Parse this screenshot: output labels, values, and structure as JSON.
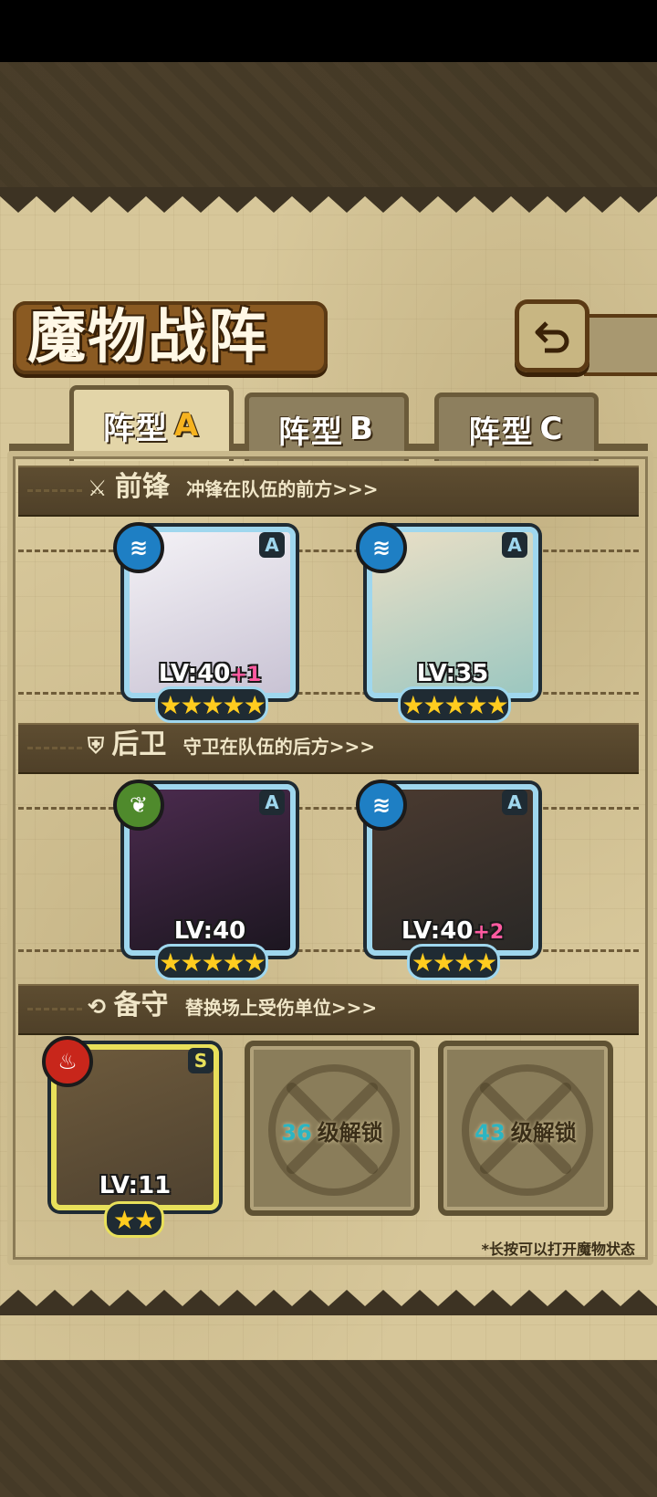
{
  "title": "魔物战阵",
  "back_button": {
    "icon": "back-arrow-icon"
  },
  "tabs": [
    {
      "label": "阵型",
      "letter": "A",
      "active": true
    },
    {
      "label": "阵型",
      "letter": "B",
      "active": false
    },
    {
      "label": "阵型",
      "letter": "C",
      "active": false
    }
  ],
  "sections": {
    "front": {
      "head": "前锋",
      "desc": "冲锋在队伍的前方>>>"
    },
    "back": {
      "head": "后卫",
      "desc": "守卫在队伍的后方>>>"
    },
    "reserve": {
      "head": "备守",
      "desc": "替换场上受伤单位>>>"
    }
  },
  "front_units": [
    {
      "level": "LV:40",
      "bonus": "+1",
      "rank": "A",
      "element": "water",
      "stars": 5
    },
    {
      "level": "LV:35",
      "bonus": "",
      "rank": "A",
      "element": "water",
      "stars": 5
    }
  ],
  "back_units": [
    {
      "level": "LV:40",
      "bonus": "",
      "rank": "A",
      "element": "nature",
      "stars": 5
    },
    {
      "level": "LV:40",
      "bonus": "+2",
      "rank": "A",
      "element": "water",
      "stars": 4
    }
  ],
  "reserve_units": [
    {
      "level": "LV:11",
      "rank": "S",
      "element": "fire",
      "stars": 2
    }
  ],
  "locked_slots": [
    {
      "level": "36",
      "label": "级解锁"
    },
    {
      "level": "43",
      "label": "级解锁"
    }
  ],
  "hint": "*长按可以打开魔物状态",
  "colors": {
    "water": "#1e7fc4",
    "nature": "#4f8a2c",
    "fire": "#c8261b",
    "star": "#ffcc1f",
    "frame": "#9fd7ee"
  }
}
